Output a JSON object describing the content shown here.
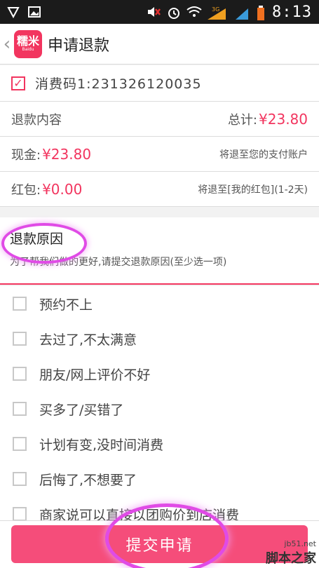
{
  "status_bar": {
    "time": "8:13",
    "network": "3G",
    "icons": [
      "shield-icon",
      "image-icon",
      "mute-icon",
      "alarm-icon",
      "wifi-icon",
      "signal-icon",
      "battery-icon"
    ]
  },
  "nav": {
    "logo_main": "糯米",
    "logo_sub": "Baidu",
    "title": "申请退款"
  },
  "coupon": {
    "text": "消费码1:231326120035",
    "checked": true
  },
  "refund_content": {
    "label": "退款内容",
    "total_label": "总计:",
    "total_value": "¥23.80"
  },
  "cash": {
    "label": "现金:",
    "value": "¥23.80",
    "hint": "将退至您的支付账户"
  },
  "red_packet": {
    "label": "红包:",
    "value": "¥0.00",
    "hint": "将退至[我的红包](1-2天)"
  },
  "reason": {
    "title": "退款原因",
    "subtitle": "为了帮我们做的更好,请提交退款原因(至少选一项)",
    "options": [
      "预约不上",
      "去过了,不太满意",
      "朋友/网上评价不好",
      "买多了/买错了",
      "计划有变,没时间消费",
      "后悔了,不想要了",
      "商家说可以直接以团购价到店消费"
    ]
  },
  "submit": {
    "label": "提交申请"
  },
  "watermark": {
    "url": "jb51.net",
    "name": "脚本之家"
  },
  "colors": {
    "accent": "#f2355f",
    "button": "#f54d7a",
    "highlight": "#e04be6"
  }
}
